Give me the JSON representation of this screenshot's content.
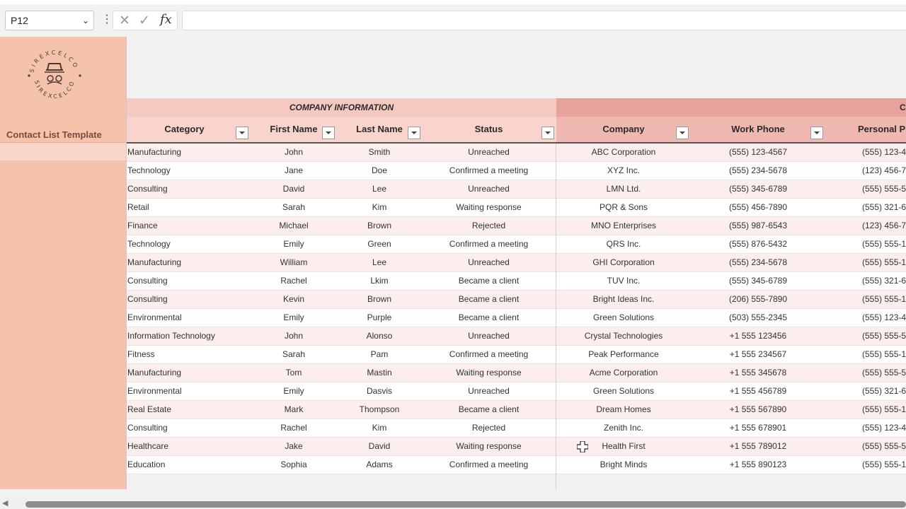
{
  "formula_bar": {
    "cell_ref": "P12",
    "fx_label": "fx",
    "formula": ""
  },
  "sidebar": {
    "logo_text": "SIREXCELCO",
    "title": "Contact List Template"
  },
  "section_headers": {
    "company_info": "COMPANY INFORMATION",
    "next_section_partial": "C"
  },
  "columns": [
    {
      "label": "Category"
    },
    {
      "label": "First Name"
    },
    {
      "label": "Last Name"
    },
    {
      "label": "Status"
    },
    {
      "label": "Company"
    },
    {
      "label": "Work Phone"
    },
    {
      "label": "Personal Ph"
    }
  ],
  "rows": [
    {
      "category": "Manufacturing",
      "first": "John",
      "last": "Smith",
      "status": "Unreached",
      "company": "ABC Corporation",
      "work": "(555) 123-4567",
      "personal": "(555) 123-4"
    },
    {
      "category": "Technology",
      "first": "Jane",
      "last": "Doe",
      "status": "Confirmed a meeting",
      "company": "XYZ Inc.",
      "work": "(555) 234-5678",
      "personal": "(123) 456-7"
    },
    {
      "category": "Consulting",
      "first": "David",
      "last": "Lee",
      "status": "Unreached",
      "company": "LMN Ltd.",
      "work": "(555) 345-6789",
      "personal": "(555) 555-5"
    },
    {
      "category": "Retail",
      "first": "Sarah",
      "last": "Kim",
      "status": "Waiting response",
      "company": "PQR & Sons",
      "work": "(555) 456-7890",
      "personal": "(555) 321-6"
    },
    {
      "category": "Finance",
      "first": "Michael",
      "last": "Brown",
      "status": "Rejected",
      "company": "MNO Enterprises",
      "work": "(555) 987-6543",
      "personal": "(123) 456-7"
    },
    {
      "category": "Technology",
      "first": "Emily",
      "last": "Green",
      "status": "Confirmed a meeting",
      "company": "QRS Inc.",
      "work": "(555) 876-5432",
      "personal": "(555) 555-1"
    },
    {
      "category": "Manufacturing",
      "first": "William",
      "last": "Lee",
      "status": "Unreached",
      "company": "GHI Corporation",
      "work": "(555) 234-5678",
      "personal": "(555) 555-1"
    },
    {
      "category": "Consulting",
      "first": "Rachel",
      "last": "Lkim",
      "status": "Became a client",
      "company": "TUV Inc.",
      "work": "(555) 345-6789",
      "personal": "(555) 321-6"
    },
    {
      "category": "Consulting",
      "first": "Kevin",
      "last": "Brown",
      "status": "Became a client",
      "company": "Bright Ideas Inc.",
      "work": "(206) 555-7890",
      "personal": "(555) 555-1"
    },
    {
      "category": "Environmental",
      "first": "Emily",
      "last": "Purple",
      "status": "Became a client",
      "company": "Green Solutions",
      "work": "(503) 555-2345",
      "personal": "(555) 123-4"
    },
    {
      "category": "Information Technology",
      "first": "John",
      "last": "Alonso",
      "status": "Unreached",
      "company": "Crystal Technologies",
      "work": "+1 555 123456",
      "personal": "(555) 555-5"
    },
    {
      "category": "Fitness",
      "first": "Sarah",
      "last": "Pam",
      "status": "Confirmed a meeting",
      "company": "Peak Performance",
      "work": "+1 555 234567",
      "personal": "(555) 555-1"
    },
    {
      "category": "Manufacturing",
      "first": "Tom",
      "last": "Mastin",
      "status": "Waiting response",
      "company": "Acme Corporation",
      "work": "+1 555 345678",
      "personal": "(555) 555-5"
    },
    {
      "category": "Environmental",
      "first": "Emily",
      "last": "Dasvis",
      "status": "Unreached",
      "company": "Green Solutions",
      "work": "+1 555 456789",
      "personal": "(555) 321-6"
    },
    {
      "category": "Real Estate",
      "first": "Mark",
      "last": "Thompson",
      "status": "Became a client",
      "company": "Dream Homes",
      "work": "+1 555 567890",
      "personal": "(555) 555-1"
    },
    {
      "category": "Consulting",
      "first": "Rachel",
      "last": "Kim",
      "status": "Rejected",
      "company": "Zenith Inc.",
      "work": "+1 555 678901",
      "personal": "(555) 123-4"
    },
    {
      "category": "Healthcare",
      "first": "Jake",
      "last": "David",
      "status": "Waiting response",
      "company": "Health First",
      "work": "+1 555 789012",
      "personal": "(555) 555-5"
    },
    {
      "category": "Education",
      "first": "Sophia",
      "last": "Adams",
      "status": "Confirmed a meeting",
      "company": "Bright Minds",
      "work": "+1 555 890123",
      "personal": "(555) 555-1"
    }
  ],
  "colors": {
    "sidebar": "#f5c2ab",
    "section_band_a": "#f5c9c0",
    "section_band_b": "#e6a29b",
    "header_a": "#f8d4cc",
    "header_b": "#eeb7b0",
    "row_alt": "#fbeeed"
  }
}
